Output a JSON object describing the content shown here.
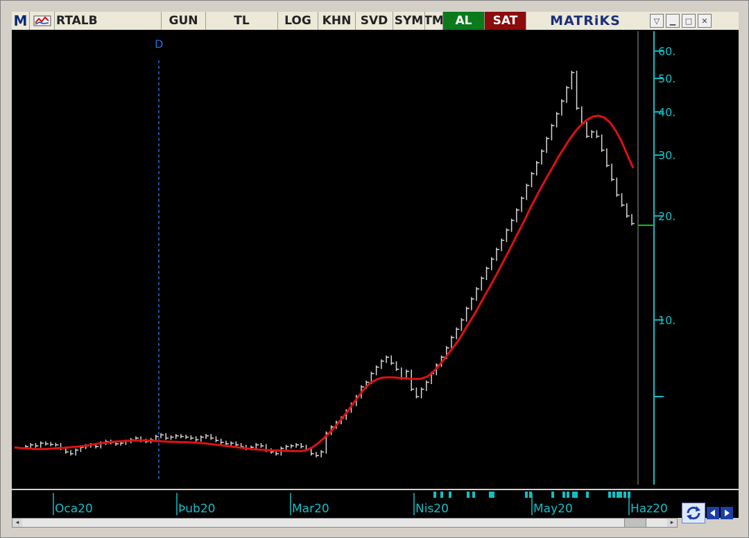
{
  "toolbar": {
    "logo": "M",
    "symbol": "RTALB",
    "period": "GUN",
    "currency": "TL",
    "scale": "LOG",
    "khn": "KHN",
    "svd": "SVD",
    "sym": "SYM",
    "tm": "TM",
    "buy": "AL",
    "sell": "SAT",
    "brand": "MATRiKS"
  },
  "colors": {
    "price_bars": "#d8d8d8",
    "moving_average": "#e01010",
    "axis": "#10c0c8",
    "marker_line": "#1a70e0",
    "buy_button": "#0a7a1a",
    "sell_button": "#8a0c0c",
    "last_price": "#18c018"
  },
  "icons": {
    "refresh": "refresh-icon",
    "prev": "arrow-left-icon",
    "next": "arrow-right-icon",
    "scroll_left": "scroll-left-icon",
    "scroll_right": "scroll-right-icon"
  },
  "chart_data": {
    "type": "line",
    "y_scale": "log",
    "ylim": [
      3.4,
      66
    ],
    "y_ticks": [
      {
        "value": 60,
        "label": "60."
      },
      {
        "value": 50,
        "label": "50."
      },
      {
        "value": 40,
        "label": "40."
      },
      {
        "value": 30,
        "label": "30."
      },
      {
        "value": 20,
        "label": "20."
      },
      {
        "value": 10,
        "label": "10."
      },
      {
        "value": 6,
        "label": ""
      }
    ],
    "x_labels": [
      "Oca20",
      "Þub20",
      "Mar20",
      "Nis20",
      "May20",
      "Haz20"
    ],
    "marker": {
      "label": "D",
      "date": "Oca20 (late)"
    },
    "grid": false,
    "legend": "none",
    "last_price": 18.8,
    "series": [
      {
        "kind": "price_bars",
        "values": [
          4.3,
          4.35,
          4.32,
          4.4,
          4.38,
          4.36,
          4.35,
          4.25,
          4.15,
          4.1,
          4.2,
          4.28,
          4.32,
          4.35,
          4.3,
          4.4,
          4.45,
          4.42,
          4.38,
          4.4,
          4.45,
          4.5,
          4.55,
          4.48,
          4.45,
          4.5,
          4.6,
          4.65,
          4.55,
          4.58,
          4.62,
          4.6,
          4.58,
          4.55,
          4.5,
          4.58,
          4.62,
          4.55,
          4.48,
          4.42,
          4.38,
          4.4,
          4.35,
          4.3,
          4.25,
          4.28,
          4.35,
          4.32,
          4.2,
          4.15,
          4.1,
          4.25,
          4.3,
          4.32,
          4.35,
          4.3,
          4.22,
          4.1,
          4.05,
          4.15,
          4.7,
          4.9,
          5.05,
          5.2,
          5.45,
          5.7,
          6.0,
          6.4,
          6.6,
          7.0,
          7.3,
          7.6,
          7.8,
          7.5,
          7.2,
          6.8,
          7.1,
          6.3,
          6.0,
          6.3,
          6.6,
          7.0,
          7.4,
          7.8,
          8.3,
          8.9,
          9.4,
          10.0,
          10.8,
          11.5,
          12.3,
          13.2,
          14.1,
          15.0,
          16.0,
          17.0,
          18.2,
          19.4,
          20.8,
          22.5,
          24.5,
          26.5,
          28.5,
          30.8,
          33.5,
          36.5,
          39.5,
          43.0,
          47.0,
          52.0,
          41.0,
          37.0,
          34.0,
          35.0,
          34.0,
          31.0,
          28.0,
          25.5,
          23.0,
          21.5,
          20.0,
          19.0
        ]
      },
      {
        "kind": "moving_average",
        "values": [
          4.28,
          4.26,
          4.25,
          4.24,
          4.23,
          4.23,
          4.24,
          4.25,
          4.26,
          4.27,
          4.29,
          4.3,
          4.32,
          4.34,
          4.37,
          4.4,
          4.42,
          4.44,
          4.45,
          4.46,
          4.47,
          4.48,
          4.48,
          4.48,
          4.47,
          4.46,
          4.45,
          4.44,
          4.44,
          4.43,
          4.43,
          4.42,
          4.41,
          4.4,
          4.38,
          4.36,
          4.34,
          4.32,
          4.3,
          4.28,
          4.26,
          4.24,
          4.22,
          4.21,
          4.2,
          4.19,
          4.19,
          4.18,
          4.18,
          4.17,
          4.17,
          4.2,
          4.28,
          4.4,
          4.55,
          4.72,
          4.92,
          5.15,
          5.4,
          5.7,
          6.0,
          6.3,
          6.55,
          6.7,
          6.8,
          6.82,
          6.82,
          6.8,
          6.78,
          6.76,
          6.75,
          6.76,
          6.85,
          7.05,
          7.35,
          7.7,
          8.1,
          8.5,
          9.0,
          9.6,
          10.2,
          10.9,
          11.7,
          12.5,
          13.4,
          14.4,
          15.5,
          16.7,
          18.0,
          19.4,
          21.0,
          22.6,
          24.3,
          26.0,
          27.8,
          29.7,
          31.6,
          33.5,
          35.3,
          36.8,
          38.0,
          38.8,
          39.0,
          38.5,
          37.2,
          35.2,
          32.8,
          30.0,
          27.5
        ]
      }
    ]
  }
}
